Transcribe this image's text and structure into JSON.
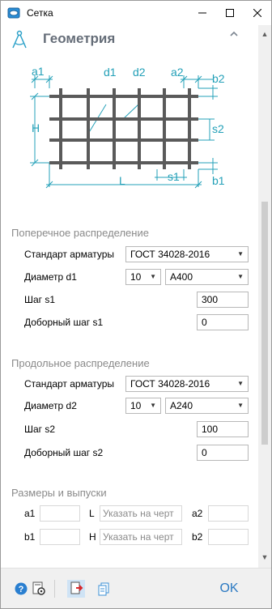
{
  "window": {
    "title": "Сетка"
  },
  "section": {
    "title": "Геометрия"
  },
  "diagram": {
    "labels": {
      "a1": "a1",
      "d1": "d1",
      "d2": "d2",
      "a2": "a2",
      "b2": "b2",
      "H": "H",
      "s2": "s2",
      "L": "L",
      "s1": "s1",
      "b1": "b1"
    }
  },
  "transverse": {
    "header": "Поперечное распределение",
    "standard_label": "Стандарт арматуры",
    "standard_value": "ГОСТ 34028-2016",
    "diameter_label": "Диаметр d1",
    "diameter_value": "10",
    "class_value": "A400",
    "step_label": "Шаг s1",
    "step_value": "300",
    "extra_label": "Доборный шаг s1",
    "extra_value": "0"
  },
  "longitudinal": {
    "header": "Продольное распределение",
    "standard_label": "Стандарт арматуры",
    "standard_value": "ГОСТ 34028-2016",
    "diameter_label": "Диаметр d2",
    "diameter_value": "10",
    "class_value": "A240",
    "step_label": "Шаг s2",
    "step_value": "100",
    "extra_label": "Доборный шаг s2",
    "extra_value": "0"
  },
  "dimensions": {
    "header": "Размеры и выпуски",
    "a1": "a1",
    "L": "L",
    "a2": "a2",
    "b1": "b1",
    "H": "H",
    "b2": "b2",
    "placeholder": "Указать на черт"
  },
  "footer": {
    "ok": "OK"
  },
  "colors": {
    "accent": "#2b79c2",
    "section_title": "#656d78",
    "group_header": "#8a8a8a",
    "diagram_line": "#23a0b8",
    "bar": "#5a5a5a"
  },
  "icons": [
    "app-icon",
    "compass-icon",
    "chevron-up-icon",
    "help-icon",
    "settings-icon",
    "export-icon",
    "copy-icon"
  ]
}
